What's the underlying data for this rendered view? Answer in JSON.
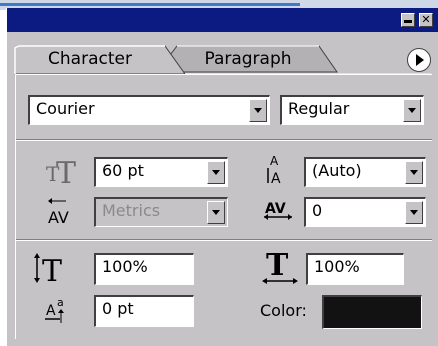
{
  "palette": {
    "title_buttons": {
      "minimize_label": "",
      "close_label": "✕"
    },
    "tabs": [
      {
        "label": "Character",
        "active": true
      },
      {
        "label": "Paragraph",
        "active": false
      }
    ]
  },
  "font": {
    "family": "Courier",
    "style": "Regular"
  },
  "metrics": {
    "size": "60 pt",
    "leading": "(Auto)",
    "kerning": "Metrics",
    "tracking": "0"
  },
  "scale": {
    "vertical": "100%",
    "horizontal": "100%",
    "baseline_shift": "0 pt",
    "color_label": "Color:",
    "color_value": "#121212"
  },
  "colors": {
    "titlebar": "#0b1b82",
    "face": "#c6c3c6"
  },
  "icons": {
    "font_size": "font-size-icon",
    "leading": "leading-icon",
    "kerning": "kerning-icon",
    "tracking": "tracking-icon",
    "vertical_scale": "vertical-scale-icon",
    "horizontal_scale": "horizontal-scale-icon",
    "baseline_shift": "baseline-shift-icon"
  }
}
